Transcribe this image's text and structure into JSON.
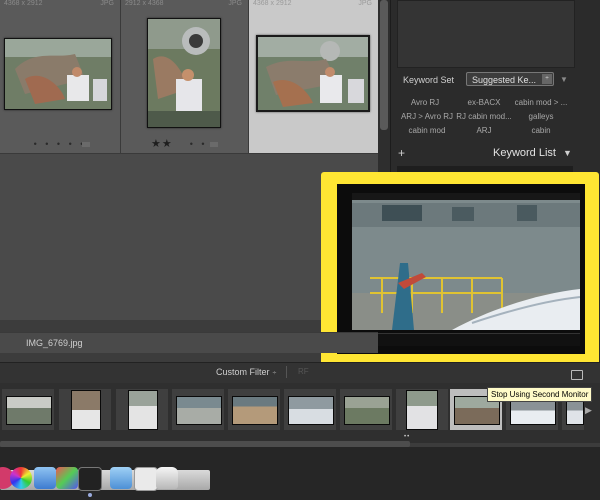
{
  "grid": {
    "cells": [
      {
        "dims": "4368 x 2912",
        "ext": "JPG",
        "rating": "• • • • •",
        "stars": 0
      },
      {
        "dims": "2912 x 4368",
        "ext": "JPG",
        "rating": "• • •",
        "stars": 2
      },
      {
        "dims": "4368 x 2912",
        "ext": "JPG",
        "rating": "",
        "stars": 0
      }
    ],
    "star_glyph": "★★"
  },
  "keywords": {
    "set_label": "Keyword Set",
    "set_value": "Suggested Ke...",
    "suggested": [
      "Avro RJ",
      "ex-BACX",
      "cabin mod > ...",
      "ARJ > Avro RJ",
      "RJ cabin mod...",
      "galleys",
      "cabin mod",
      "ARJ",
      "cabin"
    ],
    "list_title": "Keyword List",
    "plus": "+"
  },
  "filename": "IMG_6769.jpg",
  "filter": {
    "custom_filter": "Custom Filter",
    "dropdown_glyph": "÷",
    "rf": "RF"
  },
  "tooltip": "Stop Using Second Monitor",
  "film_dots": "••",
  "colors": {
    "highlight": "#ffe633",
    "tooltip_bg": "#fffbc8"
  }
}
